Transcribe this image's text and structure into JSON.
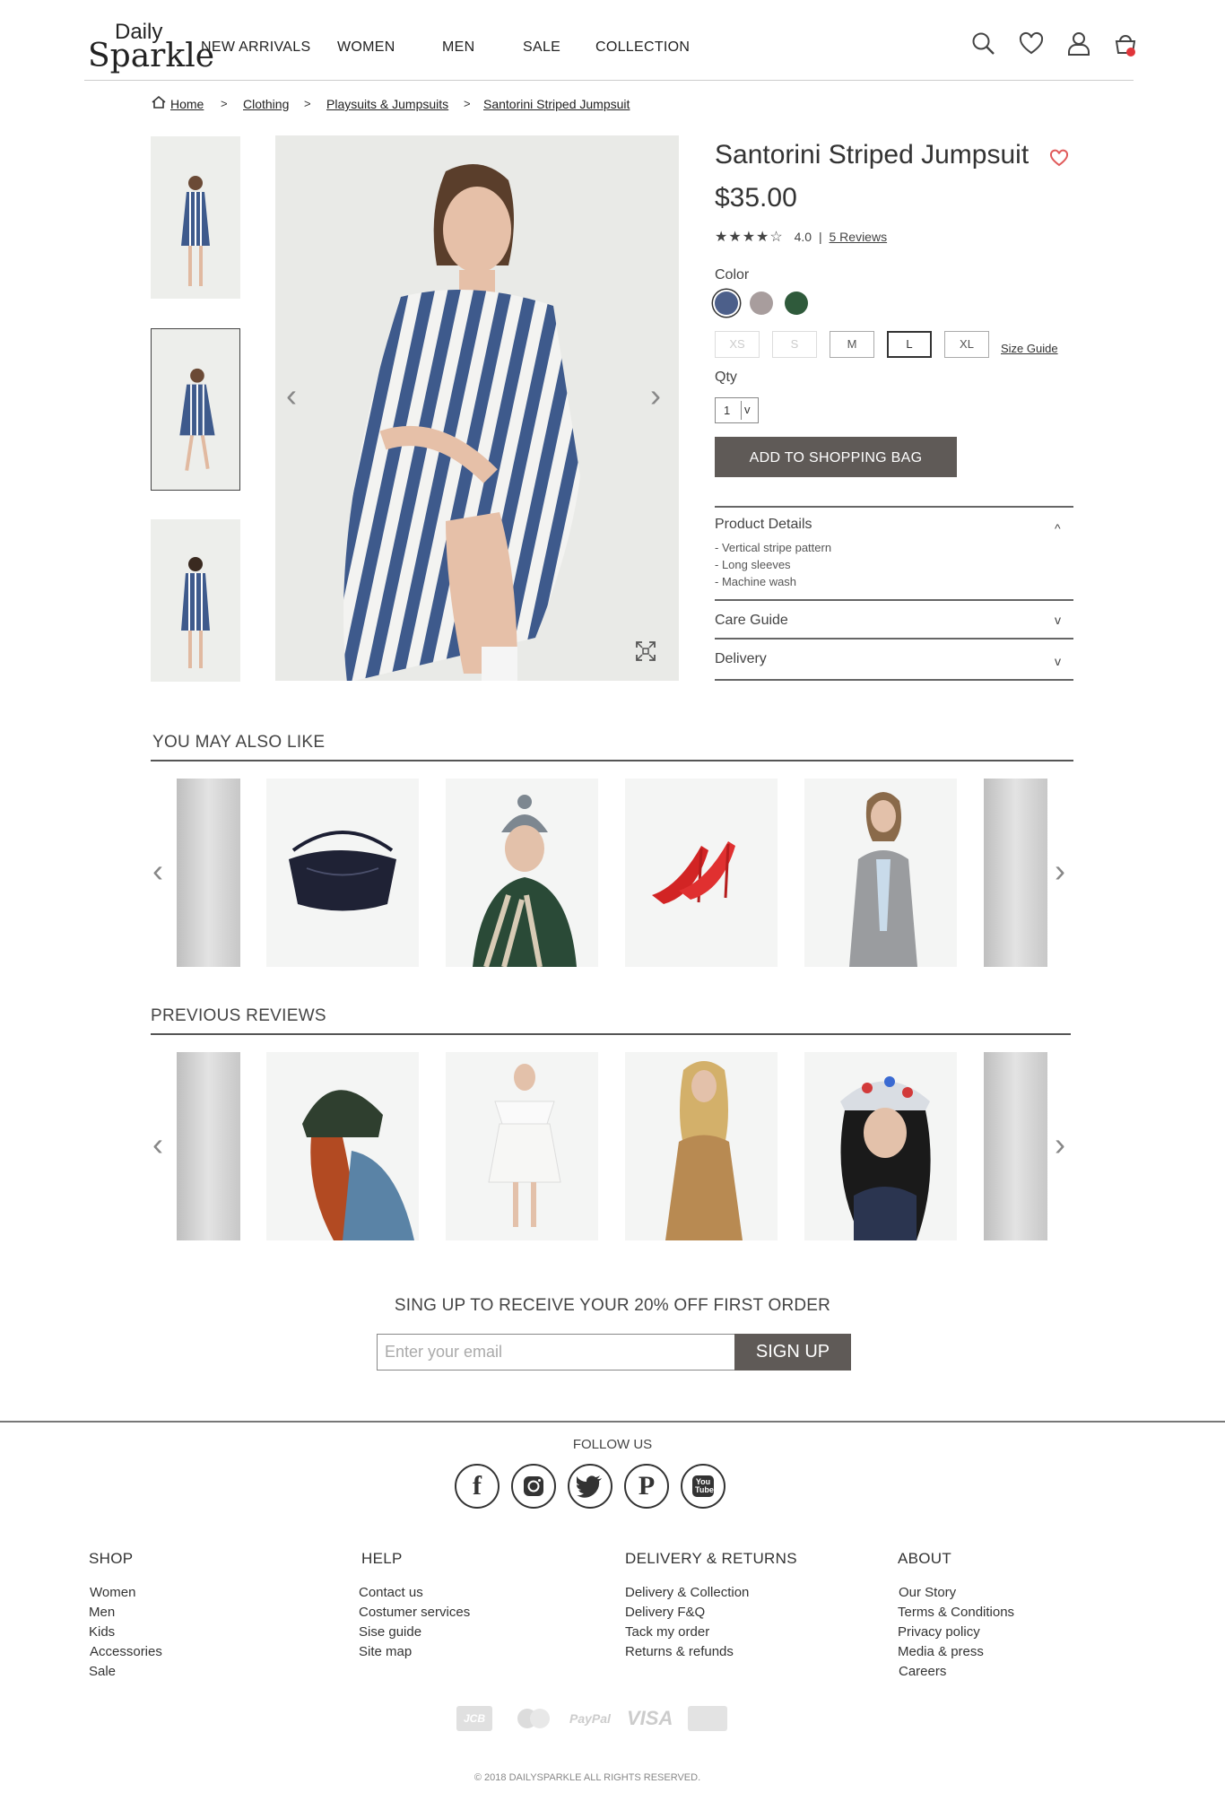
{
  "brand": {
    "line1": "Daily",
    "line2": "Sparkle"
  },
  "nav": [
    "NEW ARRIVALS",
    "WOMEN",
    "MEN",
    "SALE",
    "COLLECTION"
  ],
  "breadcrumb": [
    "Home",
    "Clothing",
    "Playsuits & Jumpsuits",
    "Santorini Striped Jumpsuit"
  ],
  "breadcrumb_sep": ">",
  "product": {
    "title": "Santorini Striped Jumpsuit",
    "price": "$35.00",
    "stars": "★★★★☆",
    "rating_value": "4.0",
    "rating_sep": "|",
    "reviews_link": "5 Reviews",
    "color_label": "Color",
    "colors": [
      "#4c5f8a",
      "#a89d9d",
      "#2f5a3b"
    ],
    "sizes": [
      "XS",
      "S",
      "M",
      "L",
      "XL"
    ],
    "size_guide": "Size Guide",
    "qty_label": "Qty",
    "qty_value": "1",
    "qty_chevron": "v",
    "add_button": "ADD TO SHOPPING BAG",
    "accordion": {
      "details_title": "Product Details",
      "details": [
        "- Vertical stripe pattern",
        "- Long sleeves",
        "- Machine wash"
      ],
      "care_title": "Care Guide",
      "delivery_title": "Delivery",
      "chev_up": "^",
      "chev_down": "v"
    }
  },
  "sections": {
    "also_like": "YOU MAY ALSO LIKE",
    "reviews": "PREVIOUS REVIEWS"
  },
  "signup": {
    "title": "SING UP TO RECEIVE YOUR 20% OFF FIRST ORDER",
    "placeholder": "Enter your email",
    "button": "SIGN UP"
  },
  "footer": {
    "follow": "FOLLOW US",
    "youtube_text": "You Tube",
    "columns": [
      {
        "title": "SHOP",
        "links": [
          "Women",
          "Men",
          "Kids",
          "Accessories",
          "Sale"
        ]
      },
      {
        "title": "HELP",
        "links": [
          "Contact us",
          "Costumer services",
          "Sise guide",
          "Site map"
        ]
      },
      {
        "title": "DELIVERY & RETURNS",
        "links": [
          "Delivery & Collection",
          "Delivery F&Q",
          "Tack my order",
          "Returns & refunds"
        ]
      },
      {
        "title": "ABOUT",
        "links": [
          "Our Story",
          "Terms & Conditions",
          "Privacy policy",
          "Media & press",
          "Careers"
        ]
      }
    ],
    "payments": [
      "JCB",
      "MasterCard",
      "PayPal",
      "VISA"
    ],
    "copyright": "© 2018 DAILYSPARKLE ALL RIGHTS RESERVED."
  },
  "colors": {
    "accent_dark": "#5f5a57",
    "wishlist": "#e05a5a",
    "cart_badge": "#e0353a",
    "stripe_blue": "#3e5a8c"
  }
}
